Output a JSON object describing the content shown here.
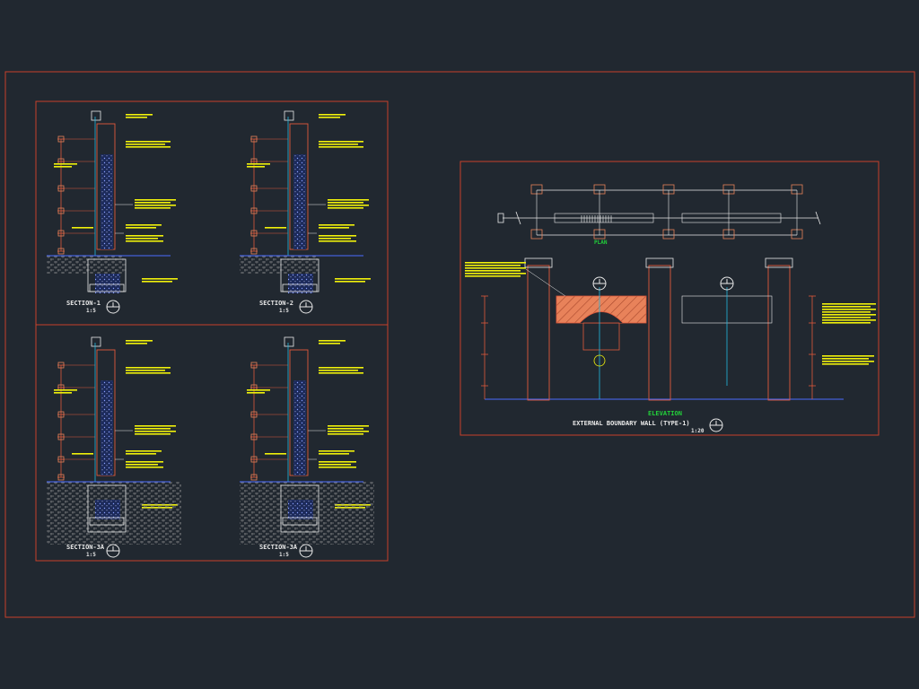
{
  "colors": {
    "background": "#212830",
    "sheet_border": "#c8412a",
    "dimension": "#e0593c",
    "annotation": "#f2f20a",
    "cyan_line": "#22b8e0",
    "white": "#e9e9e9",
    "title_green": "#22d03a",
    "hatch_brick": "#e8825a",
    "soil_pattern": "#9a9a9a",
    "concrete_blue": "#2c3f8c",
    "ground_line": "#4a6cff"
  },
  "sections": [
    {
      "title": "SECTION-1",
      "scale": "1:5"
    },
    {
      "title": "SECTION-2",
      "scale": "1:5"
    },
    {
      "title": "SECTION-3A",
      "scale": "1:5"
    },
    {
      "title": "SECTION-3A",
      "scale": "1:5"
    }
  ],
  "elevation": {
    "plan_title": "PLAN",
    "title": "ELEVATION",
    "subtitle": "EXTERNAL BOUNDARY WALL (TYPE-1)",
    "scale": "1:20"
  },
  "icons": [
    "section-marker-icon",
    "break-line-icon",
    "column-marker-icon"
  ]
}
